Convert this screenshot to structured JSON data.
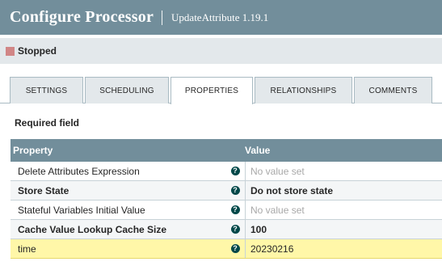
{
  "header": {
    "title": "Configure Processor",
    "subtitle": "UpdateAttribute 1.19.1"
  },
  "status": {
    "label": "Stopped",
    "color": "#d18686"
  },
  "tabs": [
    {
      "label": "SETTINGS",
      "active": false
    },
    {
      "label": "SCHEDULING",
      "active": false
    },
    {
      "label": "PROPERTIES",
      "active": true
    },
    {
      "label": "RELATIONSHIPS",
      "active": false
    },
    {
      "label": "COMMENTS",
      "active": false
    }
  ],
  "required_label": "Required field",
  "table": {
    "columns": [
      "Property",
      "Value"
    ],
    "rows": [
      {
        "name": "Delete Attributes Expression",
        "required": false,
        "help_icon": "question-circle-icon",
        "value": "No value set",
        "unset": true
      },
      {
        "name": "Store State",
        "required": true,
        "help_icon": "question-circle-icon",
        "value": "Do not store state",
        "unset": false
      },
      {
        "name": "Stateful Variables Initial Value",
        "required": false,
        "help_icon": "question-circle-icon",
        "value": "No value set",
        "unset": true
      },
      {
        "name": "Cache Value Lookup Cache Size",
        "required": true,
        "help_icon": "question-circle-icon",
        "value": "100",
        "unset": false
      },
      {
        "name": "time",
        "required": false,
        "help_icon": "question-circle-icon",
        "value": "20230216",
        "unset": false,
        "selected": true
      }
    ]
  },
  "colors": {
    "header_bg": "#728e9b",
    "help_icon": "#004849",
    "selected_row": "#fff7a8"
  }
}
